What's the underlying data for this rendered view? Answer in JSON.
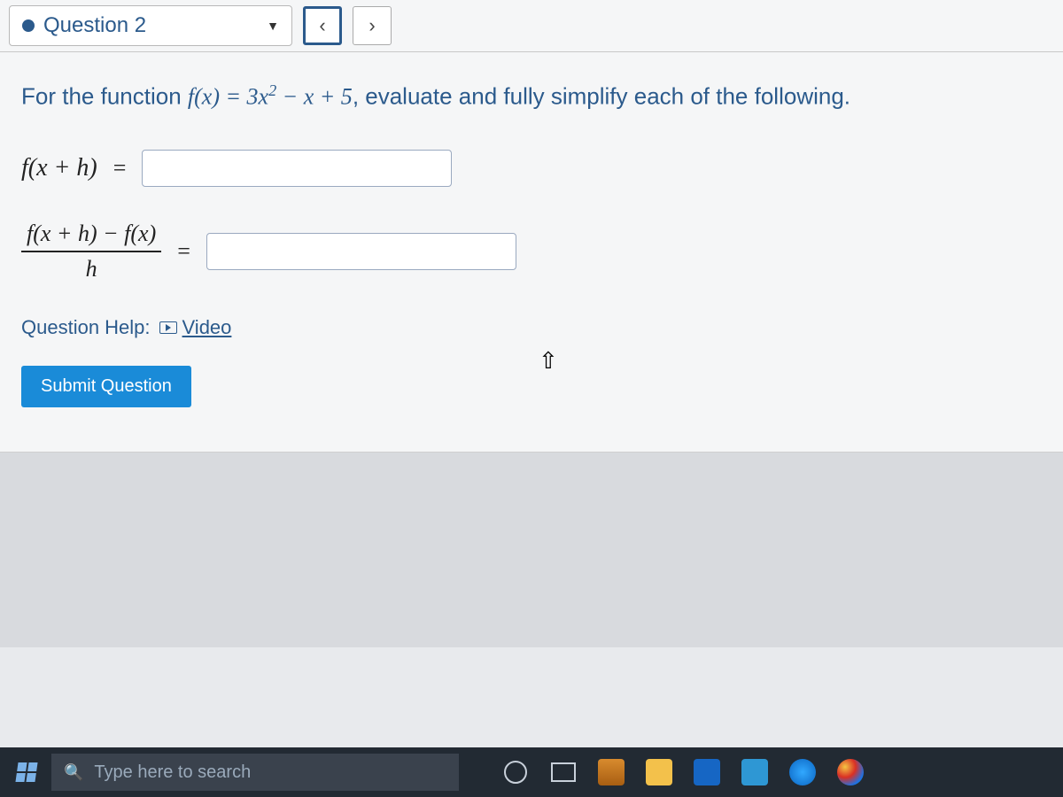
{
  "header": {
    "question_label": "Question 2",
    "prev_symbol": "‹",
    "next_symbol": "›"
  },
  "prompt": {
    "lead": "For the function",
    "fx": "f(x)",
    "eq": " = ",
    "rhs_a": "3",
    "rhs_var": "x",
    "rhs_exp": "2",
    "rhs_b": " − ",
    "rhs_var2": "x",
    "rhs_c": " + 5",
    "tail": ", evaluate and fully simplify each of the following."
  },
  "rows": {
    "r1_expr": "f(x + h)",
    "r1_eq": "=",
    "r2_num": "f(x + h) − f(x)",
    "r2_den": "h",
    "r2_eq": "="
  },
  "help": {
    "label": "Question Help:",
    "video": "Video"
  },
  "submit": {
    "label": "Submit Question"
  },
  "taskbar": {
    "search_placeholder": "Type here to search"
  }
}
